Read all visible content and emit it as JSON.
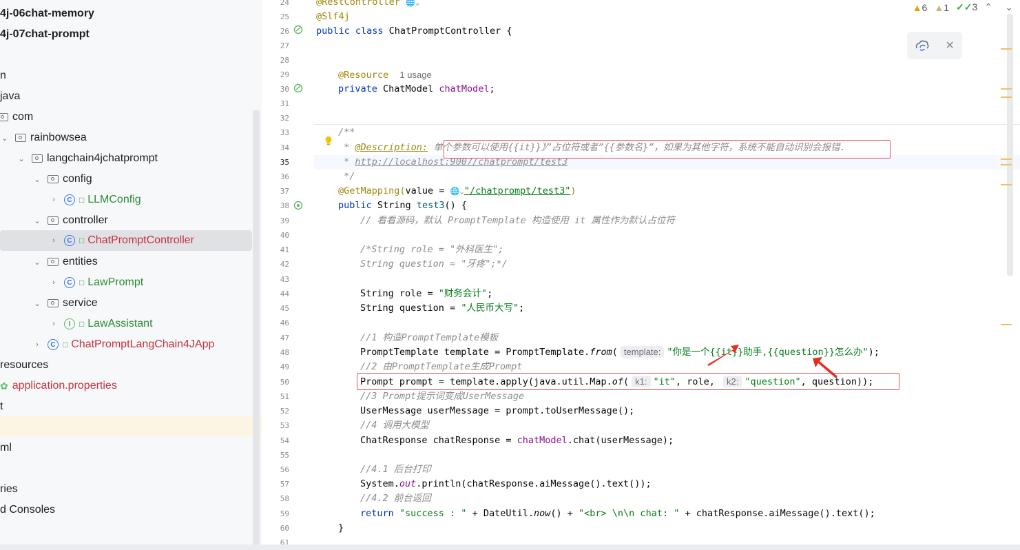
{
  "tree": {
    "rows": [
      {
        "label": "4j-06chat-memory"
      },
      {
        "label": "4j-07chat-prompt"
      },
      {
        "label": "n"
      },
      {
        "label": "java"
      },
      {
        "label": "com"
      },
      {
        "label": "rainbowsea"
      },
      {
        "label": "langchain4jchatprompt"
      },
      {
        "label": "config"
      },
      {
        "label": "LLMConfig"
      },
      {
        "label": "controller"
      },
      {
        "label": "ChatPromptController"
      },
      {
        "label": "entities"
      },
      {
        "label": "LawPrompt"
      },
      {
        "label": "service"
      },
      {
        "label": "LawAssistant"
      },
      {
        "label": "ChatPromptLangChain4JApp"
      },
      {
        "label": "resources"
      },
      {
        "label": "application.properties"
      },
      {
        "label": "t"
      },
      {
        "label": ""
      },
      {
        "label": "ml"
      },
      {
        "label": ""
      },
      {
        "label": "ries"
      },
      {
        "label": "d Consoles"
      }
    ]
  },
  "status": {
    "warnings": "6",
    "weak_warnings": "1",
    "checks": "3"
  },
  "editor": {
    "lines": [
      "24",
      "25",
      "26",
      "27",
      "28",
      "29",
      "30",
      "31",
      "32",
      "33",
      "34",
      "35",
      "36",
      "37",
      "38",
      "39",
      "40",
      "41",
      "42",
      "43",
      "44",
      "45",
      "46",
      "47",
      "48",
      "49",
      "50",
      "51",
      "52",
      "53",
      "54",
      "55",
      "56",
      "57",
      "58",
      "59",
      "60",
      "61"
    ],
    "c24": "@RestController",
    "c25": "@Slf4j",
    "c26_kw": "public class ",
    "c26_rest": "ChatPromptController {",
    "c29_ann": "@Resource",
    "c29_usage": "1 usage",
    "c30_kw": "private ",
    "c30_type": "ChatModel ",
    "c30_field": "chatModel",
    "c30_end": ";",
    "c33": "/**",
    "c34_star": " * ",
    "c34_tag": "@Description:",
    "c34_text": " 单个参数可以使用{{it}}》”占位符或者”{{参数名}”，如果为其他字符，系统不能自动识别会报错.",
    "c35_star": " * ",
    "c35_url": "http://localhost:9007/chatprompt/test3",
    "c36": " */",
    "c37_ann": "@GetMapping(",
    "c37_val": "value = ",
    "c37_str": "\"/chatprompt/test3\"",
    "c37_end": ")",
    "c38_kw": "public ",
    "c38_type": "String ",
    "c38_name": "test3",
    "c38_end": "() {",
    "c39": "// 看看源码，默认 PromptTemplate 构造使用 it 属性作为默认占位符",
    "c41": "/*String role = \"外科医生\";",
    "c42": "String question = \"牙疼\";*/",
    "c44_a": "String role = ",
    "c44_s": "\"财务会计\"",
    "c44_e": ";",
    "c45_a": "String question = ",
    "c45_s": "\"人民币大写\"",
    "c45_e": ";",
    "c47": "//1 构造PromptTemplate模板",
    "c48_a": "PromptTemplate template = PromptTemplate.",
    "c48_m": "from",
    "c48_b": "(",
    "c48_hint": "template:",
    "c48_s": "\"你是一个{{it}}助手,{{question}}怎么办\"",
    "c48_e": ");",
    "c49": "//2 由PromptTemplate生成Prompt",
    "c50_a": "Prompt prompt = template.apply(java.util.Map.",
    "c50_m": "of",
    "c50_b": "(",
    "c50_hint1": "k1:",
    "c50_s1": "\"it\"",
    "c50_c": ", role, ",
    "c50_hint2": "k2:",
    "c50_s2": "\"question\"",
    "c50_e": ", question));",
    "c51": "//3 Prompt提示词变成UserMessage",
    "c52": "UserMessage userMessage = prompt.toUserMessage();",
    "c53": "//4 调用大模型",
    "c54_a": "ChatResponse chatResponse = ",
    "c54_f": "chatModel",
    "c54_e": ".chat(userMessage);",
    "c56": "//4.1 后台打印",
    "c57_a": "System.",
    "c57_f": "out",
    "c57_e": ".println(chatResponse.aiMessage().text());",
    "c58": "//4.2 前台返回",
    "c59_kw": "return ",
    "c59_s1": "\"success : \"",
    "c59_a": " + DateUtil.",
    "c59_m": "now",
    "c59_b": "() + ",
    "c59_s2": "\"<br> \\n\\n chat: \"",
    "c59_e": " + chatResponse.aiMessage().text();",
    "c60": "}"
  },
  "colors": {
    "annotation_box": "#e05555",
    "arrow": "#e53020"
  }
}
